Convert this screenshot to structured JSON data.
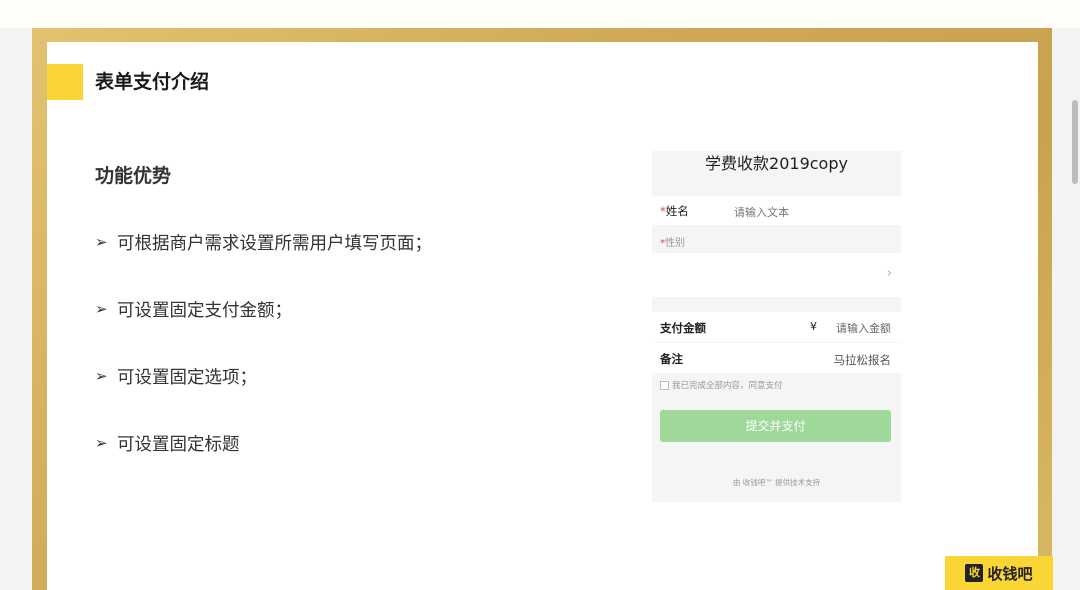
{
  "slide": {
    "title": "表单支付介绍",
    "section_heading": "功能优势",
    "bullet_glyph": "➢",
    "bullets": [
      "可根据商户需求设置所需用户填写页面；",
      "可设置固定支付金额；",
      "可设置固定选项；",
      "可设置固定标题"
    ]
  },
  "form": {
    "title": "学费收款2019copy",
    "required_mark": "*",
    "name_label": "姓名",
    "name_placeholder": "请输入文本",
    "gender_label": "性别",
    "chevron": "›",
    "pay_label": "支付金额",
    "currency": "¥",
    "amount_placeholder": "请输入金额",
    "note_label": "备注",
    "note_value": "马拉松报名",
    "agree_text": "我已完成全部内容，同意支付",
    "submit_label": "提交并支付",
    "support_text": "由 收钱吧™ 提供技术支持"
  },
  "brand": {
    "logo_mark": "收",
    "logo_text": "收钱吧"
  },
  "colors": {
    "accent_yellow": "#f9d536",
    "frame_gold": "#cfa955",
    "submit_green": "#9ed99a",
    "required_red": "#e5403a"
  }
}
